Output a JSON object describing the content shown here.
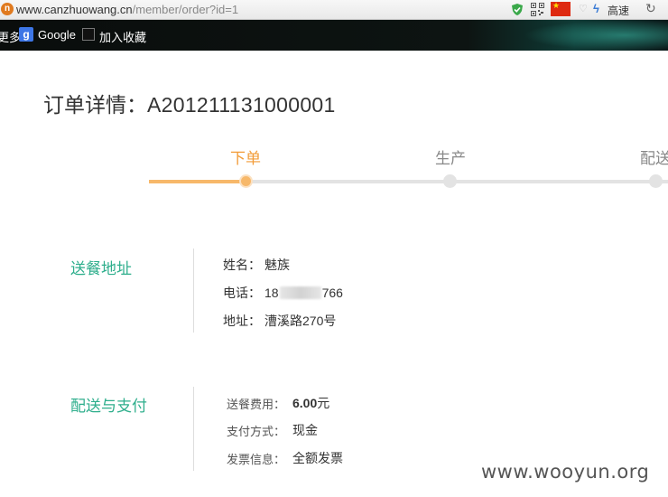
{
  "browser": {
    "url_host": "www.canzhuowang.cn",
    "url_path": "/member/order?id=1",
    "speed_mode": "高速",
    "bookmarks": {
      "more": "更多",
      "google": "Google",
      "favorite": "加入收藏"
    }
  },
  "order": {
    "title_label": "订单详情：",
    "number": "A201211131000001"
  },
  "progress": {
    "steps": [
      "下单",
      "生产",
      "配送"
    ],
    "current_step": 1,
    "colors": {
      "active": "#f29c38",
      "inactive": "#888888",
      "fill": "#f7b86a",
      "track": "#e3e3e3"
    }
  },
  "delivery_address": {
    "section_title": "送餐地址",
    "name_label": "姓名：",
    "name": "魅族",
    "phone_label": "电话：",
    "phone_prefix": "18",
    "phone_suffix": "766",
    "address_label": "地址：",
    "address": "漕溪路270号"
  },
  "delivery_payment": {
    "section_title": "配送与支付",
    "fee_label": "送餐费用：",
    "fee_amount": "6.00",
    "fee_unit": "元",
    "payment_label": "支付方式：",
    "payment_method": "现金",
    "invoice_label": "发票信息：",
    "invoice_info": "全额发票"
  },
  "section_color": "#2eae8c",
  "watermark": "www.wooyun.org"
}
